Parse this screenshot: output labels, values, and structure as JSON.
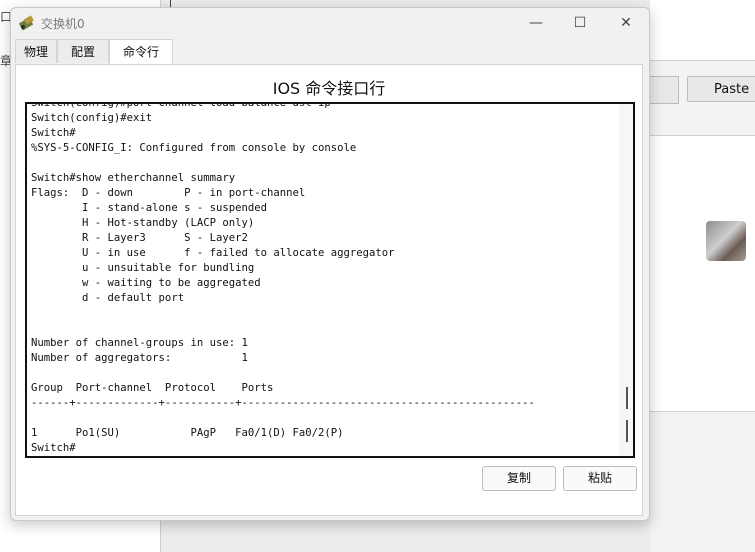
{
  "background": {
    "left_glyphs": [
      "口",
      "章"
    ],
    "paste_label": "Paste"
  },
  "window": {
    "title": "交换机0",
    "controls": {
      "minimize": "—",
      "maximize": "☐",
      "close": "✕"
    }
  },
  "tabs": [
    {
      "label": "物理",
      "active": false
    },
    {
      "label": "配置",
      "active": false
    },
    {
      "label": "命令行",
      "active": true
    }
  ],
  "cli": {
    "title": "IOS 命令接口行",
    "lines": [
      "Switch(config)#port-channel load-balance dst-ip",
      "Switch(config)#exit",
      "Switch#",
      "%SYS-5-CONFIG_I: Configured from console by console",
      "",
      "Switch#show etherchannel summary",
      "Flags:  D - down        P - in port-channel",
      "        I - stand-alone s - suspended",
      "        H - Hot-standby (LACP only)",
      "        R - Layer3      S - Layer2",
      "        U - in use      f - failed to allocate aggregator",
      "        u - unsuitable for bundling",
      "        w - waiting to be aggregated",
      "        d - default port",
      "",
      "",
      "Number of channel-groups in use: 1",
      "Number of aggregators:           1",
      "",
      "Group  Port-channel  Protocol    Ports",
      "------+-------------+-----------+----------------------------------------------",
      "",
      "1      Po1(SU)           PAgP   Fa0/1(D) Fa0/2(P)",
      "Switch#"
    ],
    "copy_button": "复制",
    "paste_button": "粘贴"
  }
}
